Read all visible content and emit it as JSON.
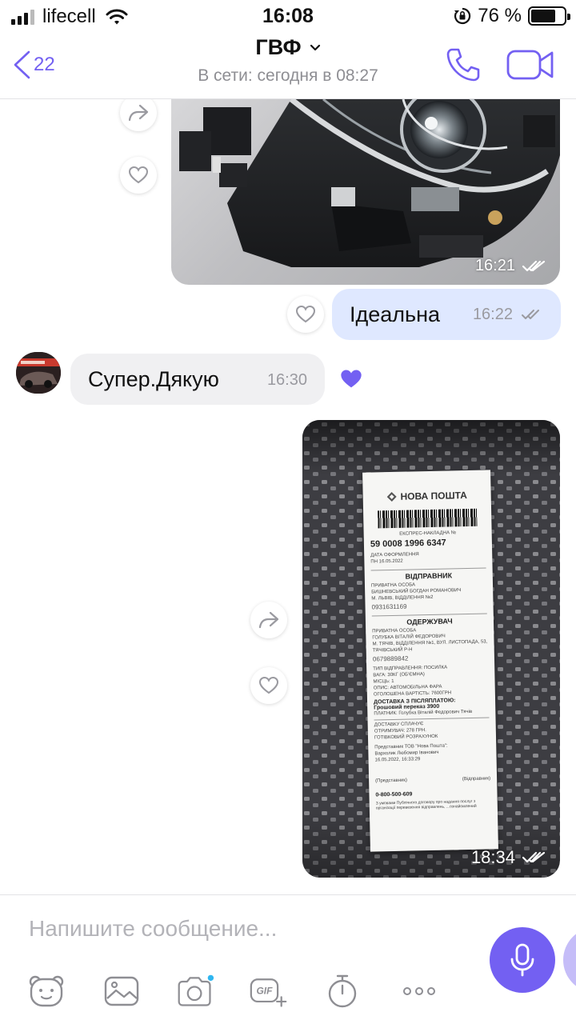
{
  "status_bar": {
    "carrier": "lifecell",
    "time": "16:08",
    "battery": "76 %",
    "battery_level": 0.76
  },
  "header": {
    "back_count": "22",
    "title": "ГВФ",
    "subtitle": "В сети: сегодня в 08:27"
  },
  "messages": {
    "photo1_time": "16:21",
    "out_text": "Ідеальна",
    "out_time": "16:22",
    "in_text": "Супер.Дякую",
    "in_time": "16:30",
    "photo2_time": "18:34"
  },
  "receipt": {
    "brand": "НОВА ПОШТА",
    "label_waybill": "ЕКСПРЕС-НАКЛАДНА №",
    "number": "59 0008 1996 6347",
    "label_date": "ДАТА ОФОРМЛЕННЯ",
    "date": "ПН 16.05.2022",
    "sender_head": "ВІДПРАВНИК",
    "sender_type": "ПРИВАТНА ОСОБА",
    "sender_name": "БИШНЕВСЬКИЙ БОГДАН РОМАНОВИЧ",
    "sender_city": "М. ЛЬВІВ, ВІДДІЛЕННЯ №2",
    "sender_phone": "0931631169",
    "recipient_head": "ОДЕРЖУВАЧ",
    "recipient_type": "ПРИВАТНА ОСОБА",
    "recipient_name": "ГОЛУБКА ВІТАЛІЙ ФЕДОРОВИЧ",
    "recipient_city": "М. ТЯЧІВ, ВІДДІЛЕННЯ №1, ВУЛ. ЛИСТОПАДА, 53, ТЯЧІВСЬКИЙ Р-Н",
    "recipient_phone": "0679889842",
    "shipment_type": "ТИП ВІДПРАВЛЕННЯ: ПОСИЛКА",
    "weight": "ВАГА: 30КГ (ОБ'ЄМНА)",
    "places": "МІСЦЬ: 1",
    "description": "ОПИС: АВТОМОБІЛЬНА ФАРА",
    "declared": "ОГОЛОШЕНА ВАРТІСТЬ: 7600ГРН",
    "cod_head": "ДОСТАВКА З ПІСЛЯПЛАТОЮ:",
    "cod_value": "Грошовий переказ 3900",
    "payer": "ПЛАТНИК: Голубка Віталій Федорович Тячів",
    "paid1": "ДОСТАВКУ СПЛАЧУЄ",
    "paid2": "ОТРИМУВАЧ: 278 ГРН.",
    "paid3": "ГОТІВКОВИЙ РОЗРАХУНОК",
    "rep": "Представник ТОВ \"Нова Пошта\":",
    "rep_name": "Вархолик Любомир Іванович",
    "rep_date": "16.05.2022, 16:33:29",
    "sign1": "(Представник)",
    "sign2": "(Відправник)",
    "hotline": "0-800-500-609",
    "footer": "З умовами Публічного договору про надання послуг з організації перевезення відправлень, ...ознайомлений"
  },
  "composer": {
    "placeholder": "Напишите сообщение..."
  },
  "colors": {
    "accent": "#7360f2",
    "outgoing_bubble": "#dfe8ff",
    "incoming_bubble": "#f0f0f2"
  }
}
